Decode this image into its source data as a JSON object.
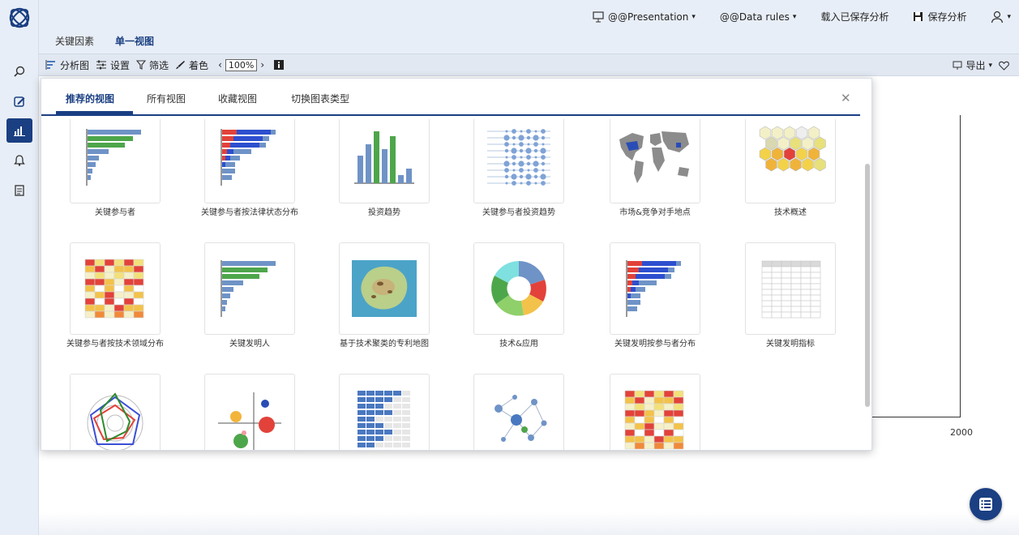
{
  "header": {
    "presentation_label": "@@Presentation",
    "data_rules_label": "@@Data rules",
    "load_saved_label": "载入已保存分析",
    "save_label": "保存分析"
  },
  "tabs": [
    {
      "label": "关键因素",
      "active": false
    },
    {
      "label": "单一视图",
      "active": true
    }
  ],
  "toolbar": {
    "analysis_label": "分析图",
    "settings_label": "设置",
    "filter_label": "筛选",
    "color_label": "着色",
    "zoom_value": "100%",
    "export_label": "导出"
  },
  "panel": {
    "tabs": [
      "推荐的视图",
      "所有视图",
      "收藏视图",
      "切换图表类型"
    ],
    "active_tab": "推荐的视图",
    "cards": [
      {
        "label": "关键参与者",
        "icon": "bar-chart-icon"
      },
      {
        "label": "关键参与者按法律状态分布",
        "icon": "stacked-bar-icon"
      },
      {
        "label": "投资趋势",
        "icon": "column-chart-icon"
      },
      {
        "label": "关键参与者投资趋势",
        "icon": "bubble-timeline-icon"
      },
      {
        "label": "市场&竞争对手地点",
        "icon": "world-map-icon"
      },
      {
        "label": "技术概述",
        "icon": "hexagon-grid-icon"
      },
      {
        "label": "关键参与者按技术领域分布",
        "icon": "heatmap-icon"
      },
      {
        "label": "关键发明人",
        "icon": "bar-chart-icon"
      },
      {
        "label": "基于技术聚类的专利地图",
        "icon": "landscape-map-icon"
      },
      {
        "label": "技术&应用",
        "icon": "donut-chart-icon"
      },
      {
        "label": "关键发明按参与者分布",
        "icon": "stacked-bar-icon"
      },
      {
        "label": "关键发明指标",
        "icon": "table-icon"
      },
      {
        "label": "",
        "icon": "radar-chart-icon"
      },
      {
        "label": "",
        "icon": "bubble-quadrant-icon"
      },
      {
        "label": "",
        "icon": "block-matrix-icon"
      },
      {
        "label": "",
        "icon": "network-graph-icon"
      },
      {
        "label": "",
        "icon": "heatmap-icon"
      }
    ]
  },
  "background": {
    "axis_tick": "2000"
  },
  "colors": {
    "primary": "#1a3f82",
    "sidebar_bg": "#e8eef7",
    "bar_blue": "#6f93c7",
    "bar_green": "#4ea64b",
    "bar_red": "#e2423a"
  }
}
